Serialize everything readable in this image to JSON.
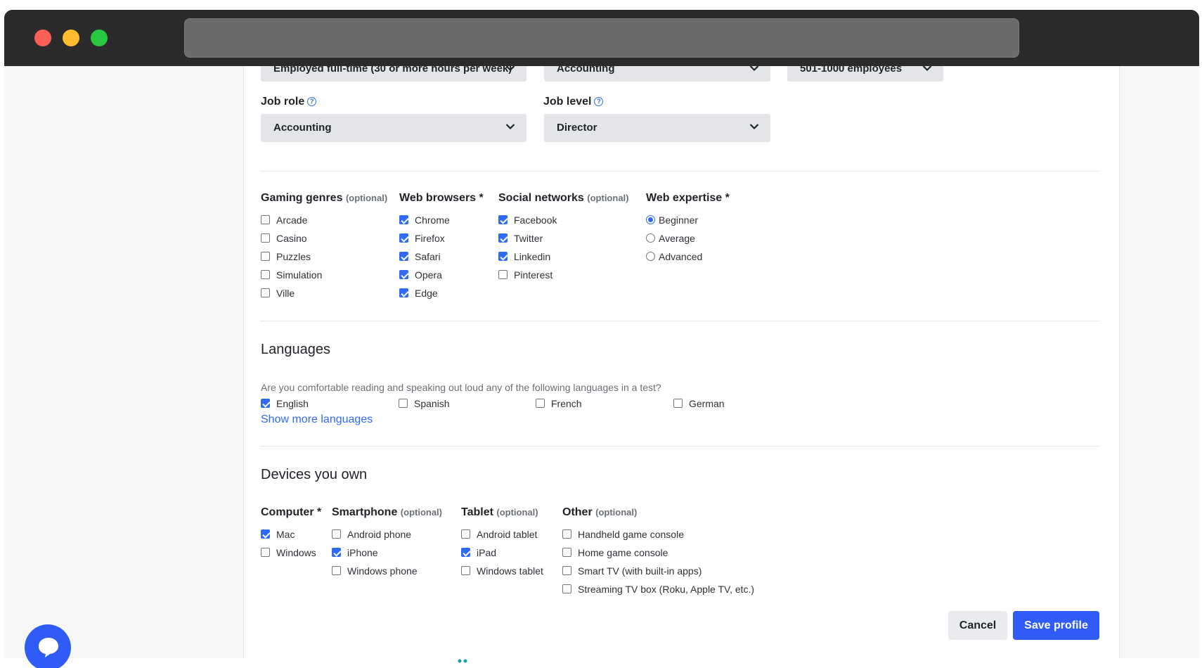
{
  "top_selects": {
    "employment": "Employed full-time (30 or more hours per week)",
    "industry": "Accounting",
    "company_size": "501-1000 employees"
  },
  "job_role": {
    "label": "Job role",
    "value": "Accounting"
  },
  "job_level": {
    "label": "Job level",
    "value": "Director"
  },
  "help_glyph": "?",
  "gaming": {
    "title": "Gaming genres",
    "optional": "(optional)",
    "items": [
      {
        "label": "Arcade",
        "checked": false
      },
      {
        "label": "Casino",
        "checked": false
      },
      {
        "label": "Puzzles",
        "checked": false
      },
      {
        "label": "Simulation",
        "checked": false
      },
      {
        "label": "Ville",
        "checked": false
      }
    ]
  },
  "browsers": {
    "title": "Web browsers *",
    "items": [
      {
        "label": "Chrome",
        "checked": true
      },
      {
        "label": "Firefox",
        "checked": true
      },
      {
        "label": "Safari",
        "checked": true
      },
      {
        "label": "Opera",
        "checked": true
      },
      {
        "label": "Edge",
        "checked": true
      }
    ]
  },
  "social": {
    "title": "Social networks",
    "optional": "(optional)",
    "items": [
      {
        "label": "Facebook",
        "checked": true
      },
      {
        "label": "Twitter",
        "checked": true
      },
      {
        "label": "Linkedin",
        "checked": true
      },
      {
        "label": "Pinterest",
        "checked": false
      }
    ]
  },
  "expertise": {
    "title": "Web expertise *",
    "items": [
      {
        "label": "Beginner",
        "checked": true
      },
      {
        "label": "Average",
        "checked": false
      },
      {
        "label": "Advanced",
        "checked": false
      }
    ]
  },
  "languages": {
    "title": "Languages",
    "question": "Are you comfortable reading and speaking out loud any of the following languages in a test?",
    "items": [
      {
        "label": "English",
        "checked": true
      },
      {
        "label": "Spanish",
        "checked": false
      },
      {
        "label": "French",
        "checked": false
      },
      {
        "label": "German",
        "checked": false
      }
    ],
    "show_more": "Show more languages"
  },
  "devices": {
    "title": "Devices you own",
    "computer": {
      "title": "Computer *",
      "items": [
        {
          "label": "Mac",
          "checked": true
        },
        {
          "label": "Windows",
          "checked": false
        }
      ]
    },
    "smartphone": {
      "title": "Smartphone",
      "optional": "(optional)",
      "items": [
        {
          "label": "Android phone",
          "checked": false
        },
        {
          "label": "iPhone",
          "checked": true
        },
        {
          "label": "Windows phone",
          "checked": false
        }
      ]
    },
    "tablet": {
      "title": "Tablet",
      "optional": "(optional)",
      "items": [
        {
          "label": "Android tablet",
          "checked": false
        },
        {
          "label": "iPad",
          "checked": true
        },
        {
          "label": "Windows tablet",
          "checked": false
        }
      ]
    },
    "other": {
      "title": "Other",
      "optional": "(optional)",
      "items": [
        {
          "label": "Handheld game console",
          "checked": false
        },
        {
          "label": "Home game console",
          "checked": false
        },
        {
          "label": "Smart TV (with built-in apps)",
          "checked": false
        },
        {
          "label": "Streaming TV box (Roku, Apple TV, etc.)",
          "checked": false
        }
      ]
    }
  },
  "buttons": {
    "cancel": "Cancel",
    "save": "Save profile"
  },
  "colors": {
    "accent": "#2f5cf6",
    "select_bg": "#e4e5e9",
    "titlebar": "#2b2b2b"
  },
  "icons": [
    "chevron-down-icon",
    "help-circle-icon",
    "chat-bubble-icon"
  ]
}
